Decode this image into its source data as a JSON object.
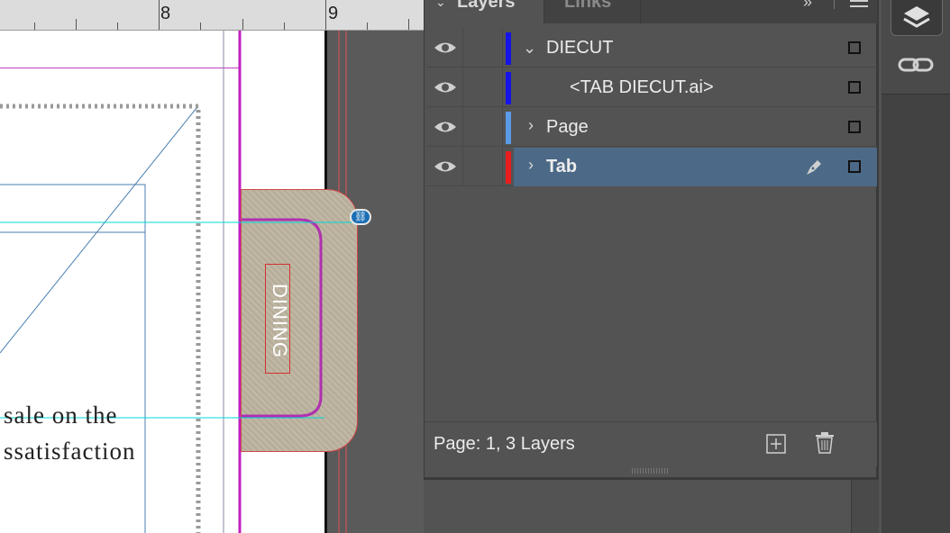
{
  "ruler": {
    "labels": [
      "8",
      "9"
    ]
  },
  "canvas": {
    "tab_text": "DINING",
    "body_lines": [
      "sale on the",
      "ssatisfaction"
    ]
  },
  "panel": {
    "tabs": [
      {
        "label": "Layers",
        "active": true
      },
      {
        "label": "Links",
        "active": false
      }
    ],
    "layers": [
      {
        "name": "DIECUT",
        "color": "#1414e6",
        "expanded": true,
        "visible": true
      },
      {
        "name": "<TAB DIECUT.ai>",
        "color": "#1414e6",
        "visible": true
      },
      {
        "name": "Page",
        "color": "#5a9ae6",
        "expanded": false,
        "visible": true
      },
      {
        "name": "Tab",
        "color": "#e81e1e",
        "expanded": false,
        "visible": true,
        "selected": true
      }
    ],
    "footer_status": "Page: 1, 3 Layers"
  },
  "colors": {
    "selection": "#4c6a87",
    "panel_bg": "#535353",
    "guide": "#00e0e0",
    "margin": "#c020c0"
  }
}
